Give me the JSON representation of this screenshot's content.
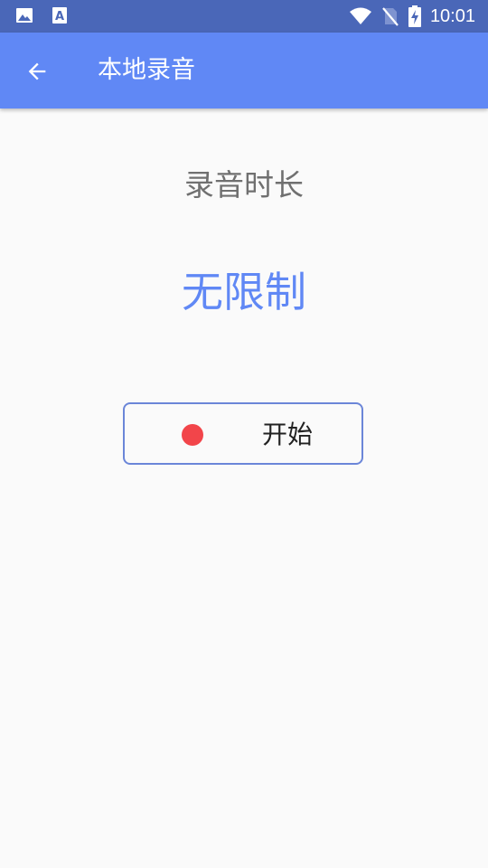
{
  "status_bar": {
    "time": "10:01",
    "icons": [
      "image-notification-icon",
      "text-notification-icon",
      "wifi-icon",
      "no-sim-icon",
      "battery-charging-icon"
    ]
  },
  "app_bar": {
    "title": "本地录音",
    "back_icon": "arrow-back-icon"
  },
  "recording": {
    "duration_label": "录音时长",
    "duration_value": "无限制"
  },
  "start_button": {
    "label": "开始",
    "icon": "record-dot-icon"
  },
  "colors": {
    "status_bar": "#4a67b8",
    "app_bar": "#6088f5",
    "accent": "#6088f5",
    "record_dot": "#f2454a",
    "background": "#fafafa"
  }
}
